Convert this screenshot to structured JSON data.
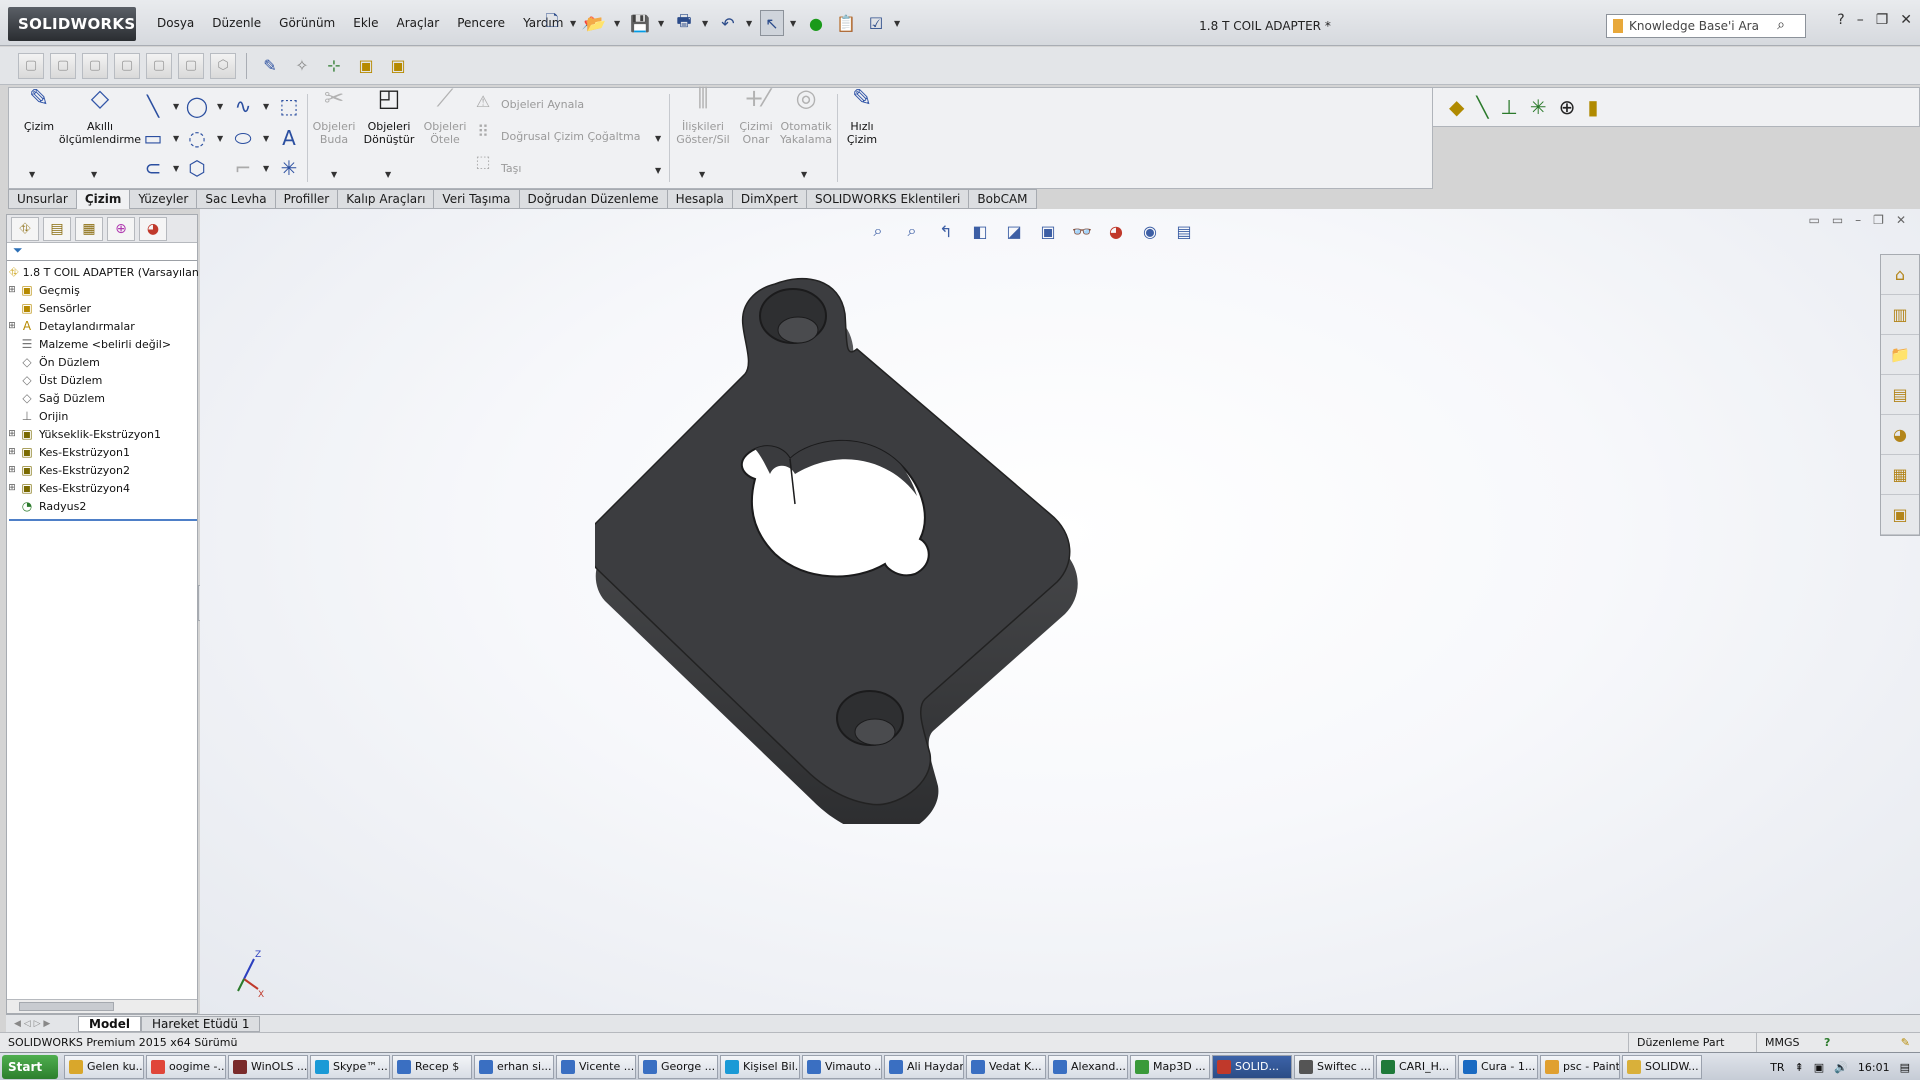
{
  "app": {
    "logo_text": "SOLIDWORKS",
    "document_title": "1.8 T COIL ADAPTER *",
    "menu": [
      "Dosya",
      "Düzenle",
      "Görünüm",
      "Ekle",
      "Araçlar",
      "Pencere",
      "Yardım"
    ],
    "search_placeholder": "Knowledge Base'i Ara"
  },
  "command_manager": {
    "cizim": "Çizim",
    "akilli_1": "Akıllı",
    "akilli_2": "ölçümlendirme",
    "buda_1": "Objeleri",
    "buda_2": "Buda",
    "donustur_1": "Objeleri",
    "donustur_2": "Dönüştür",
    "otele_1": "Objeleri",
    "otele_2": "Ötele",
    "aynala": "Objeleri Aynala",
    "cogaltma": "Doğrusal Çizim Çoğaltma",
    "tasi": "Taşı",
    "iliski_1": "İlişkileri",
    "iliski_2": "Göster/Sil",
    "onar_1": "Çizimi",
    "onar_2": "Onar",
    "yakala_1": "Otomatik",
    "yakala_2": "Yakalama",
    "hizli_1": "Hızlı",
    "hizli_2": "Çizim"
  },
  "tabs": [
    "Unsurlar",
    "Çizim",
    "Yüzeyler",
    "Sac Levha",
    "Profiller",
    "Kalıp Araçları",
    "Veri Taşıma",
    "Doğrudan Düzenleme",
    "Hesapla",
    "DimXpert",
    "SOLIDWORKS Eklentileri",
    "BobCAM"
  ],
  "active_tab": "Çizim",
  "feature_tree": {
    "root": "1.8 T COIL ADAPTER  (Varsayılan<",
    "items": [
      {
        "label": "Geçmiş",
        "icon": "history-icon",
        "expandable": true
      },
      {
        "label": "Sensörler",
        "icon": "sensor-icon",
        "expandable": false
      },
      {
        "label": "Detaylandırmalar",
        "icon": "annotation-icon",
        "expandable": true
      },
      {
        "label": "Malzeme <belirli değil>",
        "icon": "material-icon",
        "expandable": false
      },
      {
        "label": "Ön Düzlem",
        "icon": "plane-icon",
        "expandable": false
      },
      {
        "label": "Üst Düzlem",
        "icon": "plane-icon",
        "expandable": false
      },
      {
        "label": "Sağ Düzlem",
        "icon": "plane-icon",
        "expandable": false
      },
      {
        "label": "Orijin",
        "icon": "origin-icon",
        "expandable": false
      },
      {
        "label": "Yükseklik-Ekstrüzyon1",
        "icon": "extrude-icon",
        "expandable": true
      },
      {
        "label": "Kes-Ekstrüzyon1",
        "icon": "cut-extrude-icon",
        "expandable": true
      },
      {
        "label": "Kes-Ekstrüzyon2",
        "icon": "cut-extrude-icon",
        "expandable": true
      },
      {
        "label": "Kes-Ekstrüzyon4",
        "icon": "cut-extrude-icon",
        "expandable": true
      },
      {
        "label": "Radyus2",
        "icon": "fillet-icon",
        "expandable": false
      }
    ]
  },
  "model_tabs": [
    "Model",
    "Hareket Etüdü 1"
  ],
  "triad": {
    "z": "Z",
    "x": "X"
  },
  "status": {
    "left": "SOLIDWORKS Premium 2015 x64 Sürümü",
    "mode": "Düzenleme Part",
    "units": "MMGS"
  },
  "taskbar": {
    "start": "Start",
    "items": [
      "Gelen ku...",
      "oogime -...",
      "WinOLS ...",
      "Skype™...",
      "Recep $",
      "erhan si...",
      "Vicente ...",
      "George ...",
      "Kişisel Bil...",
      "Vimauto ...",
      "Ali Haydar",
      "Vedat K...",
      "Alexand...",
      "Map3D ...",
      "SOLID...",
      "Swiftec ...",
      "CARI_H...",
      "Cura - 1...",
      "psc - Paint",
      "SOLIDW..."
    ],
    "active_index": 14,
    "lang": "TR",
    "clock": "16:01"
  },
  "colors": {
    "part_fill": "#3a3b3d",
    "viewport_bg": "#ffffff",
    "tree_selection_line": "#4e7fc7"
  }
}
